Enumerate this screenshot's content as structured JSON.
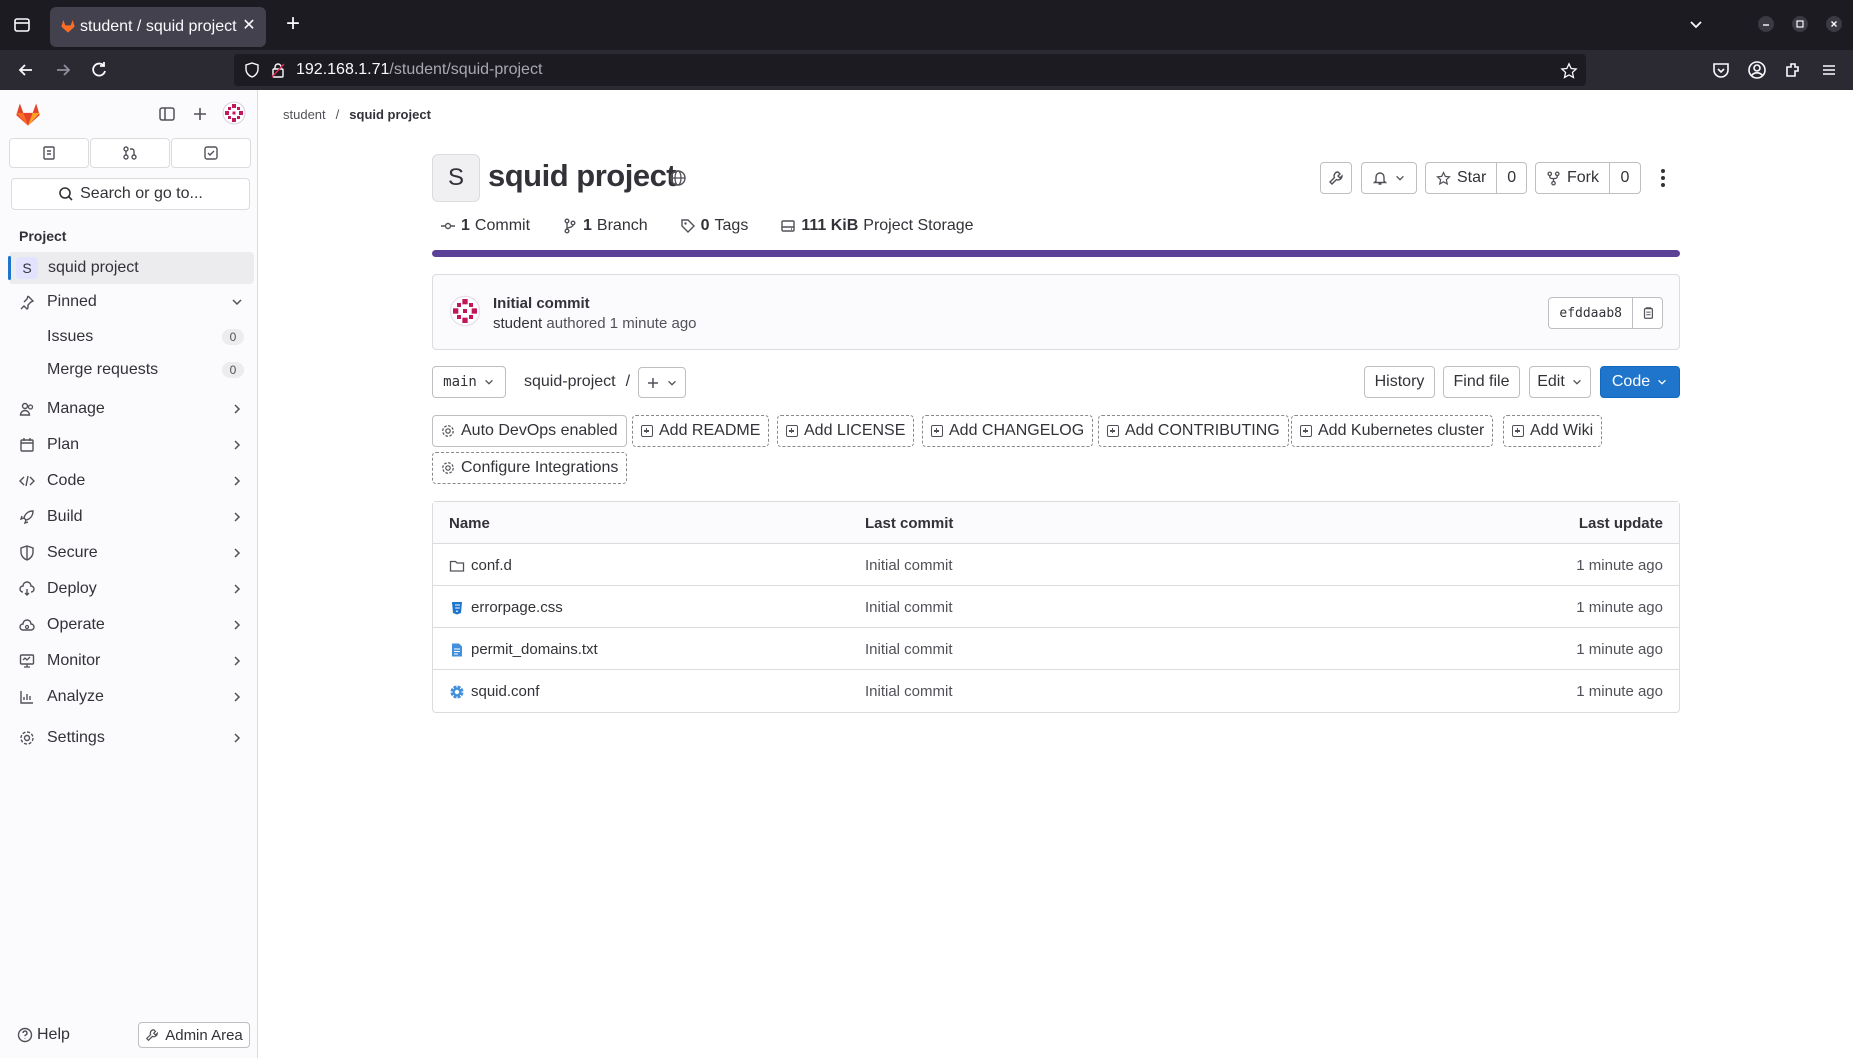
{
  "browser": {
    "tab_title": "student / squid project · GitLab",
    "url_host": "192.168.1.71",
    "url_path": "/student/squid-project"
  },
  "sidebar": {
    "search_placeholder": "Search or go to...",
    "section_title": "Project",
    "project_initial": "S",
    "project_name": "squid project",
    "pinned_label": "Pinned",
    "pinned": [
      {
        "label": "Issues",
        "count": "0"
      },
      {
        "label": "Merge requests",
        "count": "0"
      }
    ],
    "nav": [
      {
        "label": "Manage",
        "icon": "users-icon"
      },
      {
        "label": "Plan",
        "icon": "calendar-icon"
      },
      {
        "label": "Code",
        "icon": "code-icon"
      },
      {
        "label": "Build",
        "icon": "rocket-icon"
      },
      {
        "label": "Secure",
        "icon": "shield-icon"
      },
      {
        "label": "Deploy",
        "icon": "deploy-icon"
      },
      {
        "label": "Operate",
        "icon": "cloud-icon"
      },
      {
        "label": "Monitor",
        "icon": "monitor-icon"
      },
      {
        "label": "Analyze",
        "icon": "chart-icon"
      }
    ],
    "settings_label": "Settings",
    "help_label": "Help",
    "admin_label": "Admin Area"
  },
  "breadcrumb": {
    "root": "student",
    "current": "squid project"
  },
  "project": {
    "initial": "S",
    "title": "squid project",
    "star_label": "Star",
    "star_count": "0",
    "fork_label": "Fork",
    "fork_count": "0"
  },
  "stats": {
    "commits_count": "1",
    "commits_label": "Commit",
    "branches_count": "1",
    "branches_label": "Branch",
    "tags_count": "0",
    "tags_label": "Tags",
    "storage_value": "111 KiB",
    "storage_label": "Project Storage",
    "storage_fill_fraction": 1.0
  },
  "last_commit": {
    "title": "Initial commit",
    "author": "student",
    "meta": "authored 1 minute ago",
    "sha": "efddaab8"
  },
  "repo_toolbar": {
    "branch": "main",
    "path": "squid-project",
    "path_sep": "/",
    "history": "History",
    "find_file": "Find file",
    "edit": "Edit",
    "code": "Code"
  },
  "actions": {
    "auto_devops": "Auto DevOps enabled",
    "add_readme": "Add README",
    "add_license": "Add LICENSE",
    "add_changelog": "Add CHANGELOG",
    "add_contributing": "Add CONTRIBUTING",
    "add_k8s": "Add Kubernetes cluster",
    "add_wiki": "Add Wiki",
    "configure_integrations": "Configure Integrations"
  },
  "files": {
    "headers": {
      "name": "Name",
      "last_commit": "Last commit",
      "last_update": "Last update"
    },
    "rows": [
      {
        "name": "conf.d",
        "type": "folder",
        "commit": "Initial commit",
        "updated": "1 minute ago"
      },
      {
        "name": "errorpage.css",
        "type": "css",
        "commit": "Initial commit",
        "updated": "1 minute ago"
      },
      {
        "name": "permit_domains.txt",
        "type": "text",
        "commit": "Initial commit",
        "updated": "1 minute ago"
      },
      {
        "name": "squid.conf",
        "type": "config",
        "commit": "Initial commit",
        "updated": "1 minute ago"
      }
    ]
  },
  "colors": {
    "accent": "#1f75cb",
    "storage_bar": "#5c4297",
    "gitlab_orange": "#fc6d26"
  }
}
